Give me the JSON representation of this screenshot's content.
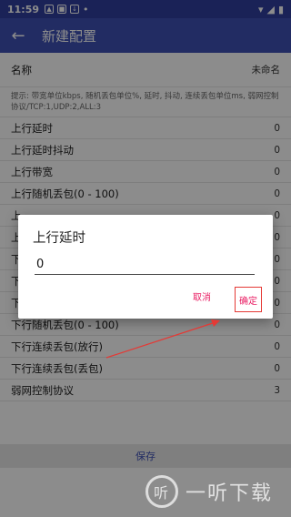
{
  "status_bar": {
    "time": "11:59",
    "icons": [
      "notification-icon",
      "notification-icon",
      "download-icon",
      "dot-icon"
    ],
    "right_icons": [
      "wifi-icon",
      "signal-icon",
      "battery-icon"
    ]
  },
  "app_bar": {
    "title": "新建配置"
  },
  "config": {
    "name_label": "名称",
    "name_value": "未命名",
    "hint": "提示: 带宽单位kbps, 随机丢包单位%, 延时, 抖动, 连续丢包单位ms, 弱网控制协议/TCP:1,UDP:2,ALL:3",
    "rows": [
      {
        "label": "上行延时",
        "value": "0"
      },
      {
        "label": "上行延时抖动",
        "value": "0"
      },
      {
        "label": "上行带宽",
        "value": "0"
      },
      {
        "label": "上行随机丢包(0 - 100)",
        "value": "0"
      },
      {
        "label": "上",
        "value": "0"
      },
      {
        "label": "上",
        "value": "0"
      },
      {
        "label": "下",
        "value": "0"
      },
      {
        "label": "下",
        "value": "0"
      },
      {
        "label": "下行带宽",
        "value": "0"
      },
      {
        "label": "下行随机丢包(0 - 100)",
        "value": "0"
      },
      {
        "label": "下行连续丢包(放行)",
        "value": "0"
      },
      {
        "label": "下行连续丢包(丢包)",
        "value": "0"
      },
      {
        "label": "弱网控制协议",
        "value": "3"
      }
    ],
    "save_label": "保存"
  },
  "dialog": {
    "title": "上行延时",
    "input_value": "0",
    "cancel_label": "取消",
    "ok_label": "确定"
  },
  "watermark": {
    "text": "一听下载"
  },
  "colors": {
    "primary": "#3f51b5",
    "status_bar": "#303f9f",
    "accent": "#e91e63",
    "annotation": "#e53935"
  }
}
